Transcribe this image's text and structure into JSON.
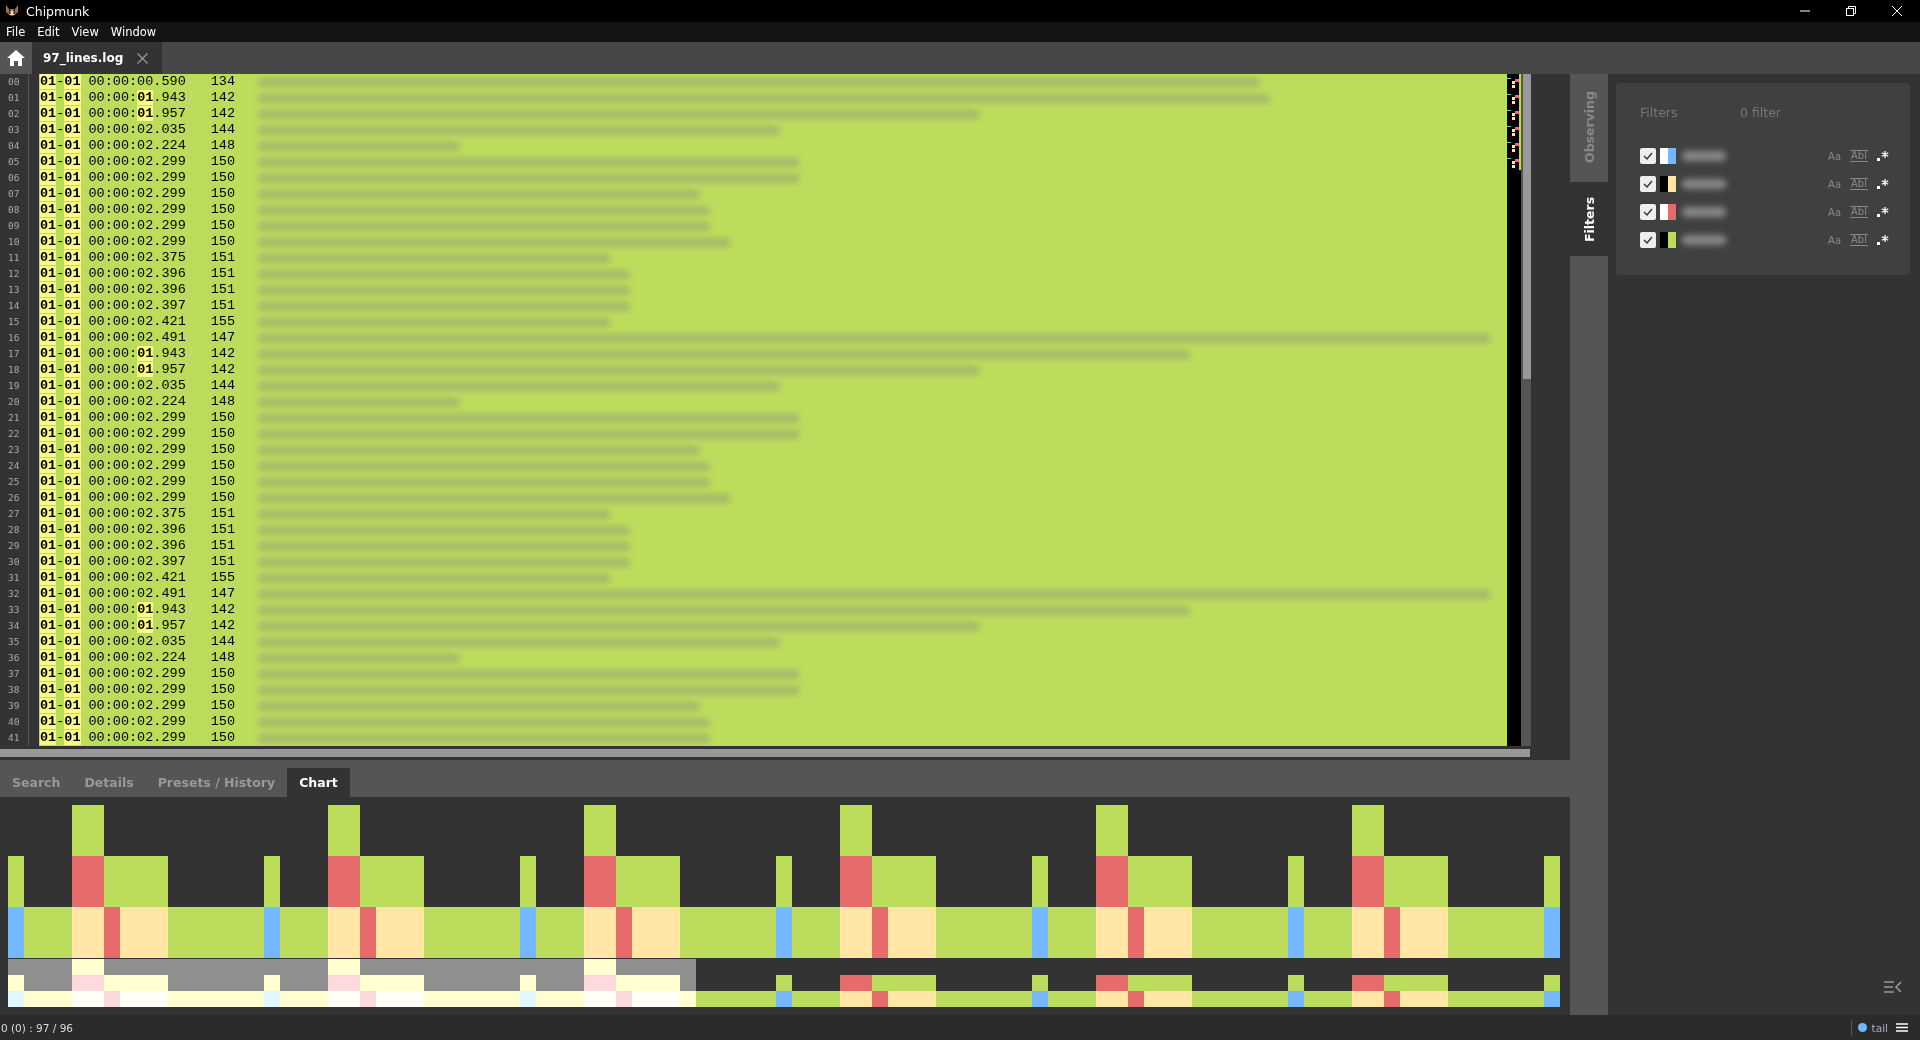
{
  "window": {
    "title": "Chipmunk"
  },
  "menu": [
    "File",
    "Edit",
    "View",
    "Window"
  ],
  "tabs": [
    {
      "label": "97_lines.log",
      "selected": true
    }
  ],
  "log": {
    "rows": [
      {
        "line": "00",
        "date": "01-01",
        "time": "00:00:00.590",
        "pid": "134",
        "time_match": false
      },
      {
        "line": "01",
        "date": "01-01",
        "time": "00:00:01.943",
        "pid": "142",
        "time_match": true
      },
      {
        "line": "02",
        "date": "01-01",
        "time": "00:00:01.957",
        "pid": "142",
        "time_match": true
      },
      {
        "line": "03",
        "date": "01-01",
        "time": "00:00:02.035",
        "pid": "144",
        "time_match": false
      },
      {
        "line": "04",
        "date": "01-01",
        "time": "00:00:02.224",
        "pid": "148",
        "time_match": false
      },
      {
        "line": "05",
        "date": "01-01",
        "time": "00:00:02.299",
        "pid": "150",
        "time_match": false
      },
      {
        "line": "06",
        "date": "01-01",
        "time": "00:00:02.299",
        "pid": "150",
        "time_match": false
      },
      {
        "line": "07",
        "date": "01-01",
        "time": "00:00:02.299",
        "pid": "150",
        "time_match": false
      },
      {
        "line": "08",
        "date": "01-01",
        "time": "00:00:02.299",
        "pid": "150",
        "time_match": false
      },
      {
        "line": "09",
        "date": "01-01",
        "time": "00:00:02.299",
        "pid": "150",
        "time_match": false
      },
      {
        "line": "10",
        "date": "01-01",
        "time": "00:00:02.299",
        "pid": "150",
        "time_match": false
      },
      {
        "line": "11",
        "date": "01-01",
        "time": "00:00:02.375",
        "pid": "151",
        "time_match": false
      },
      {
        "line": "12",
        "date": "01-01",
        "time": "00:00:02.396",
        "pid": "151",
        "time_match": false
      },
      {
        "line": "13",
        "date": "01-01",
        "time": "00:00:02.396",
        "pid": "151",
        "time_match": false
      },
      {
        "line": "14",
        "date": "01-01",
        "time": "00:00:02.397",
        "pid": "151",
        "time_match": false
      },
      {
        "line": "15",
        "date": "01-01",
        "time": "00:00:02.421",
        "pid": "155",
        "time_match": false
      },
      {
        "line": "16",
        "date": "01-01",
        "time": "00:00:02.491",
        "pid": "147",
        "time_match": false
      },
      {
        "line": "17",
        "date": "01-01",
        "time": "00:00:01.943",
        "pid": "142",
        "time_match": true
      },
      {
        "line": "18",
        "date": "01-01",
        "time": "00:00:01.957",
        "pid": "142",
        "time_match": true
      },
      {
        "line": "19",
        "date": "01-01",
        "time": "00:00:02.035",
        "pid": "144",
        "time_match": false
      },
      {
        "line": "20",
        "date": "01-01",
        "time": "00:00:02.224",
        "pid": "148",
        "time_match": false
      },
      {
        "line": "21",
        "date": "01-01",
        "time": "00:00:02.299",
        "pid": "150",
        "time_match": false
      },
      {
        "line": "22",
        "date": "01-01",
        "time": "00:00:02.299",
        "pid": "150",
        "time_match": false
      },
      {
        "line": "23",
        "date": "01-01",
        "time": "00:00:02.299",
        "pid": "150",
        "time_match": false
      },
      {
        "line": "24",
        "date": "01-01",
        "time": "00:00:02.299",
        "pid": "150",
        "time_match": false
      },
      {
        "line": "25",
        "date": "01-01",
        "time": "00:00:02.299",
        "pid": "150",
        "time_match": false
      },
      {
        "line": "26",
        "date": "01-01",
        "time": "00:00:02.299",
        "pid": "150",
        "time_match": false
      },
      {
        "line": "27",
        "date": "01-01",
        "time": "00:00:02.375",
        "pid": "151",
        "time_match": false
      },
      {
        "line": "28",
        "date": "01-01",
        "time": "00:00:02.396",
        "pid": "151",
        "time_match": false
      },
      {
        "line": "29",
        "date": "01-01",
        "time": "00:00:02.396",
        "pid": "151",
        "time_match": false
      },
      {
        "line": "30",
        "date": "01-01",
        "time": "00:00:02.397",
        "pid": "151",
        "time_match": false
      },
      {
        "line": "31",
        "date": "01-01",
        "time": "00:00:02.421",
        "pid": "155",
        "time_match": false
      },
      {
        "line": "32",
        "date": "01-01",
        "time": "00:00:02.491",
        "pid": "147",
        "time_match": false
      },
      {
        "line": "33",
        "date": "01-01",
        "time": "00:00:01.943",
        "pid": "142",
        "time_match": true
      },
      {
        "line": "34",
        "date": "01-01",
        "time": "00:00:01.957",
        "pid": "142",
        "time_match": true
      },
      {
        "line": "35",
        "date": "01-01",
        "time": "00:00:02.035",
        "pid": "144",
        "time_match": false
      },
      {
        "line": "36",
        "date": "01-01",
        "time": "00:00:02.224",
        "pid": "148",
        "time_match": false
      },
      {
        "line": "37",
        "date": "01-01",
        "time": "00:00:02.299",
        "pid": "150",
        "time_match": false
      },
      {
        "line": "38",
        "date": "01-01",
        "time": "00:00:02.299",
        "pid": "150",
        "time_match": false
      },
      {
        "line": "39",
        "date": "01-01",
        "time": "00:00:02.299",
        "pid": "150",
        "time_match": false
      },
      {
        "line": "40",
        "date": "01-01",
        "time": "00:00:02.299",
        "pid": "150",
        "time_match": false
      },
      {
        "line": "41",
        "date": "01-01",
        "time": "00:00:02.299",
        "pid": "150",
        "time_match": false
      }
    ]
  },
  "side_tabs": [
    {
      "label": "Observing",
      "selected": false
    },
    {
      "label": "Filters",
      "selected": true
    }
  ],
  "filters": {
    "title": "Filters",
    "count": "0 filter",
    "items": [
      {
        "checked": true,
        "swatches": [
          {
            "color": "#ffffff"
          },
          {
            "color": "#74b9ff"
          }
        ],
        "case_label": "Aa",
        "word_label": "Abl",
        "match_case": false,
        "whole_word": false,
        "regex": false
      },
      {
        "checked": true,
        "swatches": [
          {
            "color": "#000000"
          },
          {
            "color": "#ffe6a6"
          }
        ],
        "case_label": "Aa",
        "word_label": "Abl",
        "match_case": false,
        "whole_word": false,
        "regex": false
      },
      {
        "checked": true,
        "swatches": [
          {
            "color": "#ffffff"
          },
          {
            "color": "#e66b6b"
          }
        ],
        "case_label": "Aa",
        "word_label": "Abl",
        "match_case": false,
        "whole_word": false,
        "regex": false
      },
      {
        "checked": true,
        "swatches": [
          {
            "color": "#000000"
          },
          {
            "color": "#bcdc5c"
          }
        ],
        "case_label": "Aa",
        "word_label": "Abl",
        "match_case": false,
        "whole_word": false,
        "regex": false
      }
    ]
  },
  "bottom_tabs": [
    {
      "label": "Search",
      "selected": false
    },
    {
      "label": "Details",
      "selected": false
    },
    {
      "label": "Presets / History",
      "selected": false
    },
    {
      "label": "Chart",
      "selected": true
    }
  ],
  "status_bar": {
    "position": "0 (0) : 97 / 96",
    "tail": "tail"
  }
}
